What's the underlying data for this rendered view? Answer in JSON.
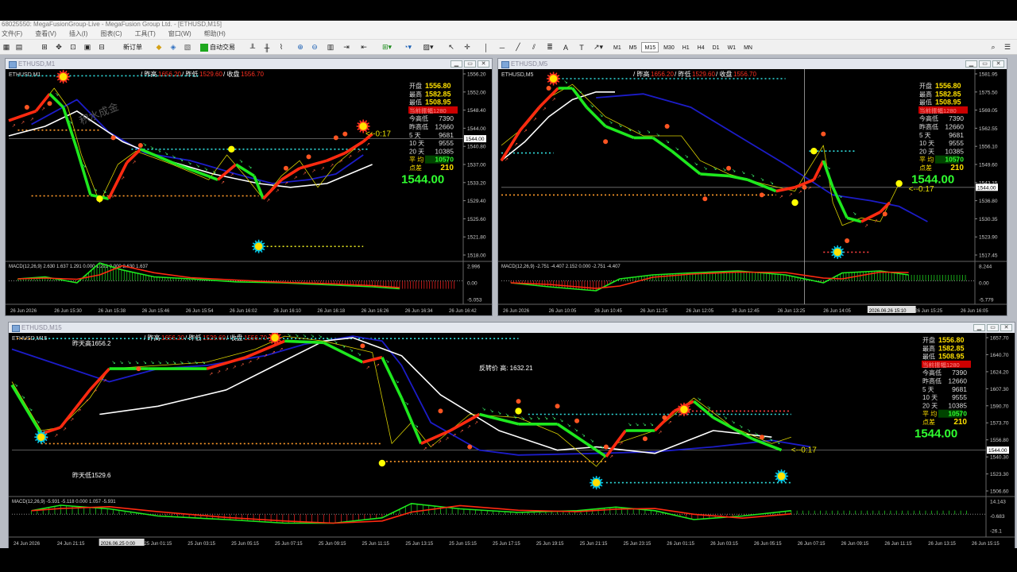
{
  "app": {
    "title": "68025550: MegaFusionGroup-Live - MegaFusion Group Ltd. - [ETHUSD,M15]",
    "menu": [
      "文件(F)",
      "查看(V)",
      "插入(I)",
      "图表(C)",
      "工具(T)",
      "窗口(W)",
      "帮助(H)"
    ]
  },
  "toolbar": {
    "new_order": "新订单",
    "auto_trade": "自动交易",
    "timeframes": [
      "M1",
      "M5",
      "M15",
      "M30",
      "H1",
      "H4",
      "D1",
      "W1",
      "MN"
    ],
    "active_tf": "M15",
    "icons": [
      "new-chart-icon",
      "profiles-icon",
      "zoom-in-icon",
      "zoom-out-icon",
      "tile-icon",
      "autoscroll-icon",
      "bar-chart-icon",
      "candle-icon",
      "line-chart-icon",
      "cursor-icon",
      "crosshair-icon",
      "vertical-line-icon",
      "horizontal-line-icon",
      "trendline-icon",
      "channel-icon",
      "fibo-icon",
      "text-icon",
      "arrows-icon",
      "search-icon"
    ]
  },
  "symbol_info": {
    "open_label": "开盘",
    "open": "1556.80",
    "high_label": "最高",
    "high": "1582.85",
    "low_label": "最低",
    "low": "1508.95",
    "range_label": "当前振幅1280",
    "today_range_label": "今高低",
    "today_range": "7390",
    "yday_range_label": "昨高低",
    "yday_range": "12660",
    "d5_label": "5 天",
    "d5": "9681",
    "d10_label": "10 天",
    "d10": "9555",
    "d20_label": "20 天",
    "d20": "10385",
    "avg_label": "平 均",
    "avg": "10570",
    "spread_label": "点差",
    "spread": "210",
    "price": "1544.00"
  },
  "header_line": {
    "yday_high_label": "/ 昨高",
    "yday_high": "1656.20",
    "yday_low_label": "/ 昨低",
    "yday_low": "1529.60",
    "close_label": "/ 收盘",
    "close": "1556.70"
  },
  "countdown": "<--0:17",
  "watermark": "积水成金",
  "colors": {
    "up": "#ff2a10",
    "down": "#1ee81e",
    "ma_slow": "#1c1cc8",
    "ma_white": "#ffffff",
    "dot_yellow": "#ffff00",
    "dot_red": "#ff5522",
    "aqua": "#00e5e5",
    "orange": "#ff9a2a",
    "macd_main": "#1ee81e",
    "macd_signal": "#ff2a10"
  },
  "charts": [
    {
      "id": "m1",
      "window_title": "ETHUSD,M1",
      "symbol_label": "ETHUSD,M1",
      "y_ticks": [
        "1556.20",
        "1552.00",
        "1548.40",
        "1544.00",
        "1540.80",
        "1537.00",
        "1533.20",
        "1529.40",
        "1525.60",
        "1521.80",
        "1518.00"
      ],
      "price_tag": "1544.00",
      "macd_label": "MACD(12,26,9) 2.630 1.637 1.291 0.000 1.291 0.000 2.630 1.637",
      "macd_ticks": [
        "2.996",
        "0.00",
        "-5.053"
      ],
      "x_ticks": [
        "26 Jun 2026",
        "26 Jun 15:30",
        "26 Jun 15:38",
        "26 Jun 15:46",
        "26 Jun 15:54",
        "26 Jun 16:02",
        "26 Jun 16:10",
        "26 Jun 16:18",
        "26 Jun 16:26",
        "26 Jun 16:34",
        "26 Jun 16:42"
      ]
    },
    {
      "id": "m5",
      "window_title": "ETHUSD,M5",
      "symbol_label": "ETHUSD,M5",
      "y_ticks": [
        "1581.95",
        "1575.50",
        "1569.05",
        "1562.55",
        "1556.10",
        "1549.60",
        "1543.15",
        "1536.80",
        "1530.35",
        "1523.90",
        "1517.45"
      ],
      "price_tag": "1544.00",
      "macd_label": "MACD(12,26,9) -2.751 -4.407 2.152 0.000 -2.751 -4.407",
      "macd_ticks": [
        "8.244",
        "0.00",
        "-5.779"
      ],
      "x_ticks": [
        "26 Jun 2026",
        "26 Jun 10:05",
        "26 Jun 10:45",
        "26 Jun 11:25",
        "26 Jun 12:05",
        "26 Jun 12:45",
        "26 Jun 13:25",
        "26 Jun 14:05",
        "2026.06.26 15:10",
        "26 Jun 15:25",
        "26 Jun 16:05"
      ]
    },
    {
      "id": "m15",
      "window_title": "ETHUSD,M15",
      "symbol_label": "ETHUSD,M15",
      "y_ticks": [
        "1657.70",
        "1640.70",
        "1624.20",
        "1607.30",
        "1590.70",
        "1573.70",
        "1556.80",
        "1540.30",
        "1523.30",
        "1506.60"
      ],
      "price_tag": "1544.00",
      "yday_high_text": "昨天高1656.2",
      "yday_low_text": "昨天低1529.6",
      "reversal_text": "反转价 高: 1632.21",
      "macd_label": "MACD(12,26,9) -5.931 -5.118 0.000 1.057 -5.931",
      "macd_ticks": [
        "14.143",
        "-0.683",
        "-26.1"
      ],
      "x_ticks": [
        "24 Jun 2026",
        "24 Jun 21:15",
        "2026.06.25 0:00",
        "25 Jun 01:15",
        "25 Jun 03:15",
        "25 Jun 05:15",
        "25 Jun 07:15",
        "25 Jun 09:15",
        "25 Jun 11:15",
        "25 Jun 13:15",
        "25 Jun 15:15",
        "25 Jun 17:15",
        "25 Jun 19:15",
        "25 Jun 21:15",
        "25 Jun 23:15",
        "26 Jun 01:15",
        "26 Jun 03:15",
        "26 Jun 05:15",
        "26 Jun 07:15",
        "26 Jun 09:15",
        "26 Jun 11:15",
        "26 Jun 13:15",
        "26 Jun 15:15"
      ]
    }
  ]
}
